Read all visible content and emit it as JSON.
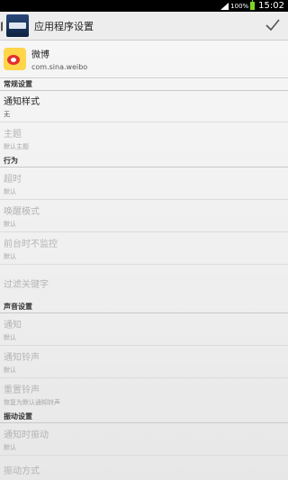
{
  "status_bar": {
    "battery_percent": "100%",
    "time": "15:02"
  },
  "action_bar": {
    "title": "应用程序设置"
  },
  "app": {
    "name": "微博",
    "package": "com.sina.weibo"
  },
  "sections": {
    "general": {
      "header": "常规设置"
    },
    "behavior": {
      "header": "行为"
    },
    "sound": {
      "header": "声音设置"
    },
    "vibration": {
      "header": "振动设置"
    }
  },
  "prefs": {
    "notif_style": {
      "title": "通知样式",
      "summary": "无"
    },
    "theme": {
      "title": "主题",
      "summary": "默认主题"
    },
    "timeout": {
      "title": "超时",
      "summary": "默认"
    },
    "wake_mode": {
      "title": "唤醒模式",
      "summary": "默认"
    },
    "no_fg_monitor": {
      "title": "前台时不监控",
      "summary": "默认"
    },
    "filter_keywords": {
      "title": "过滤关键字"
    },
    "notify": {
      "title": "通知",
      "summary": "默认"
    },
    "notif_ringtone": {
      "title": "通知铃声",
      "summary": "默认"
    },
    "reset_ringtone": {
      "title": "重置铃声",
      "summary": "恢复为默认通知铃声"
    },
    "vibrate_on_notify": {
      "title": "通知时振动",
      "summary": "默认"
    },
    "vibrate_mode": {
      "title": "振动方式"
    }
  }
}
